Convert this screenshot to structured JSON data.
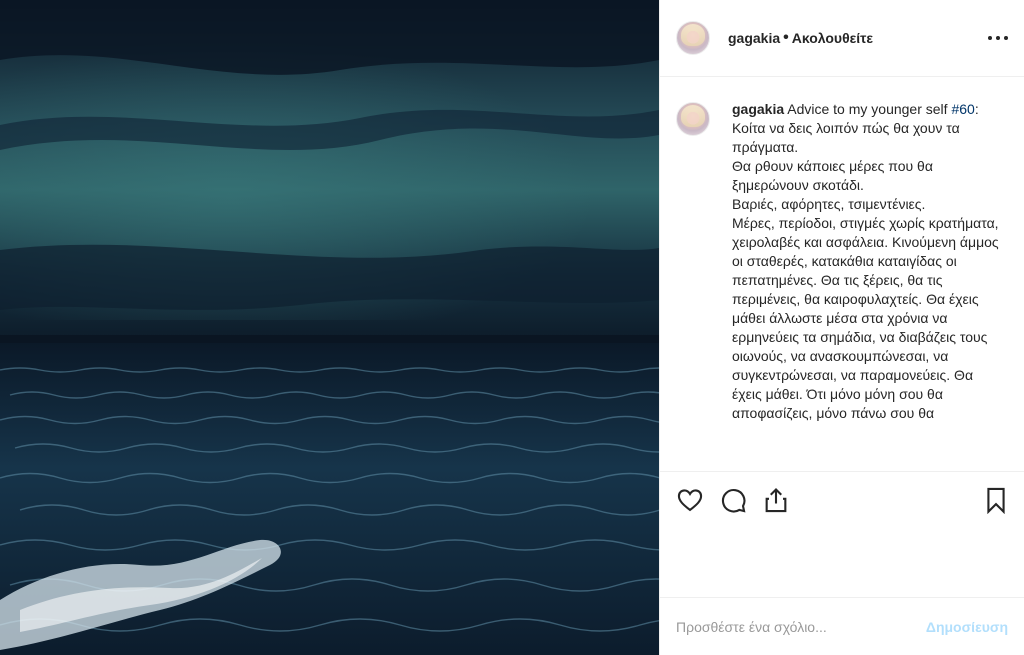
{
  "post": {
    "image_alt": "stormy sea",
    "header": {
      "username": "gagakia",
      "separator": "•",
      "follow_status": "Ακολουθείτε"
    },
    "caption": {
      "username": "gagakia",
      "text_intro": " Advice to my younger self ",
      "hashtag": "#60",
      "text_body": ": Κοίτα να δεις λοιπόν πώς θα χουν τα πράγματα.\nΘα ρθουν κάποιες μέρες που θα ξημερώνουν σκοτάδι.\nΒαριές, αφόρητες, τσιμεντένιες.\nΜέρες, περίοδοι, στιγμές χωρίς κρατήματα, χειρολαβές και ασφάλεια. Κινούμενη άμμος οι σταθερές, κατακάθια καταιγίδας οι πεπατημένες. Θα τις ξέρεις, θα τις περιμένεις, θα καιροφυλαχτείς. Θα έχεις μάθει άλλωστε μέσα στα χρόνια να ερμηνεύεις τα σημάδια, να διαβάζεις τους οιωνούς, να ανασκουμπώνεσαι, να συγκεντρώνεσαι, να παραμονεύεις. Θα έχεις μάθει. Ότι μόνο μόνη σου θα αποφασίζεις, μόνο πάνω σου θα"
    },
    "actions": {
      "like_icon": "heart-icon",
      "comment_icon": "comment-icon",
      "share_icon": "share-icon",
      "save_icon": "bookmark-icon"
    },
    "comment": {
      "placeholder": "Προσθέστε ένα σχόλιο...",
      "post_label": "Δημοσίευση"
    }
  },
  "colors": {
    "link": "#003569",
    "post_button_disabled": "#b2dffc",
    "text": "#262626"
  }
}
